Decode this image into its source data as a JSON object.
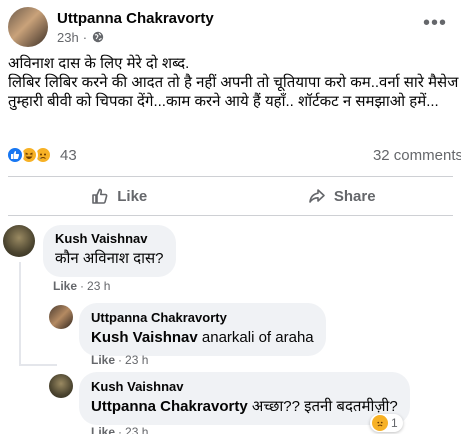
{
  "post": {
    "author": "Uttpanna Chakravorty",
    "time": "23h",
    "time_separator": "·",
    "more_glyph": "•••",
    "text": "अविनाश दास के लिए मेरे दो शब्द.\nलिबिर लिबिर करने की आदत तो है नहीं अपनी तो चूतियापा करो कम..वर्ना सारे मैसेज तुम्हारी बीवी को चिपका देंगे...काम करने आये हैं यहाँ.. शॉर्टकट न समझाओ हमें..."
  },
  "reactions": {
    "count": "43",
    "comments_label": "32 comments",
    "icons": [
      "like-reaction",
      "haha-reaction",
      "sad-reaction"
    ]
  },
  "actions": {
    "like_label": "Like",
    "share_label": "Share"
  },
  "comments": [
    {
      "author": "Kush Vaishnav",
      "text": "कौन अविनाश दास?",
      "like": "Like",
      "time": "23 h"
    },
    {
      "author": "Uttpanna Chakravorty",
      "mention": "Kush Vaishnav",
      "text": " anarkali of araha",
      "like": "Like",
      "time": "23 h"
    },
    {
      "author": "Kush Vaishnav",
      "mention": "Uttpanna Chakravorty",
      "text": " अच्छा?? इतनी बदतमीज़ी?",
      "like": "Like",
      "time": "23 h",
      "reaction_count": "1"
    }
  ],
  "colors": {
    "brand_blue": "#1877f2",
    "secondary_text": "#65676b",
    "bubble_bg": "#f0f2f5"
  }
}
